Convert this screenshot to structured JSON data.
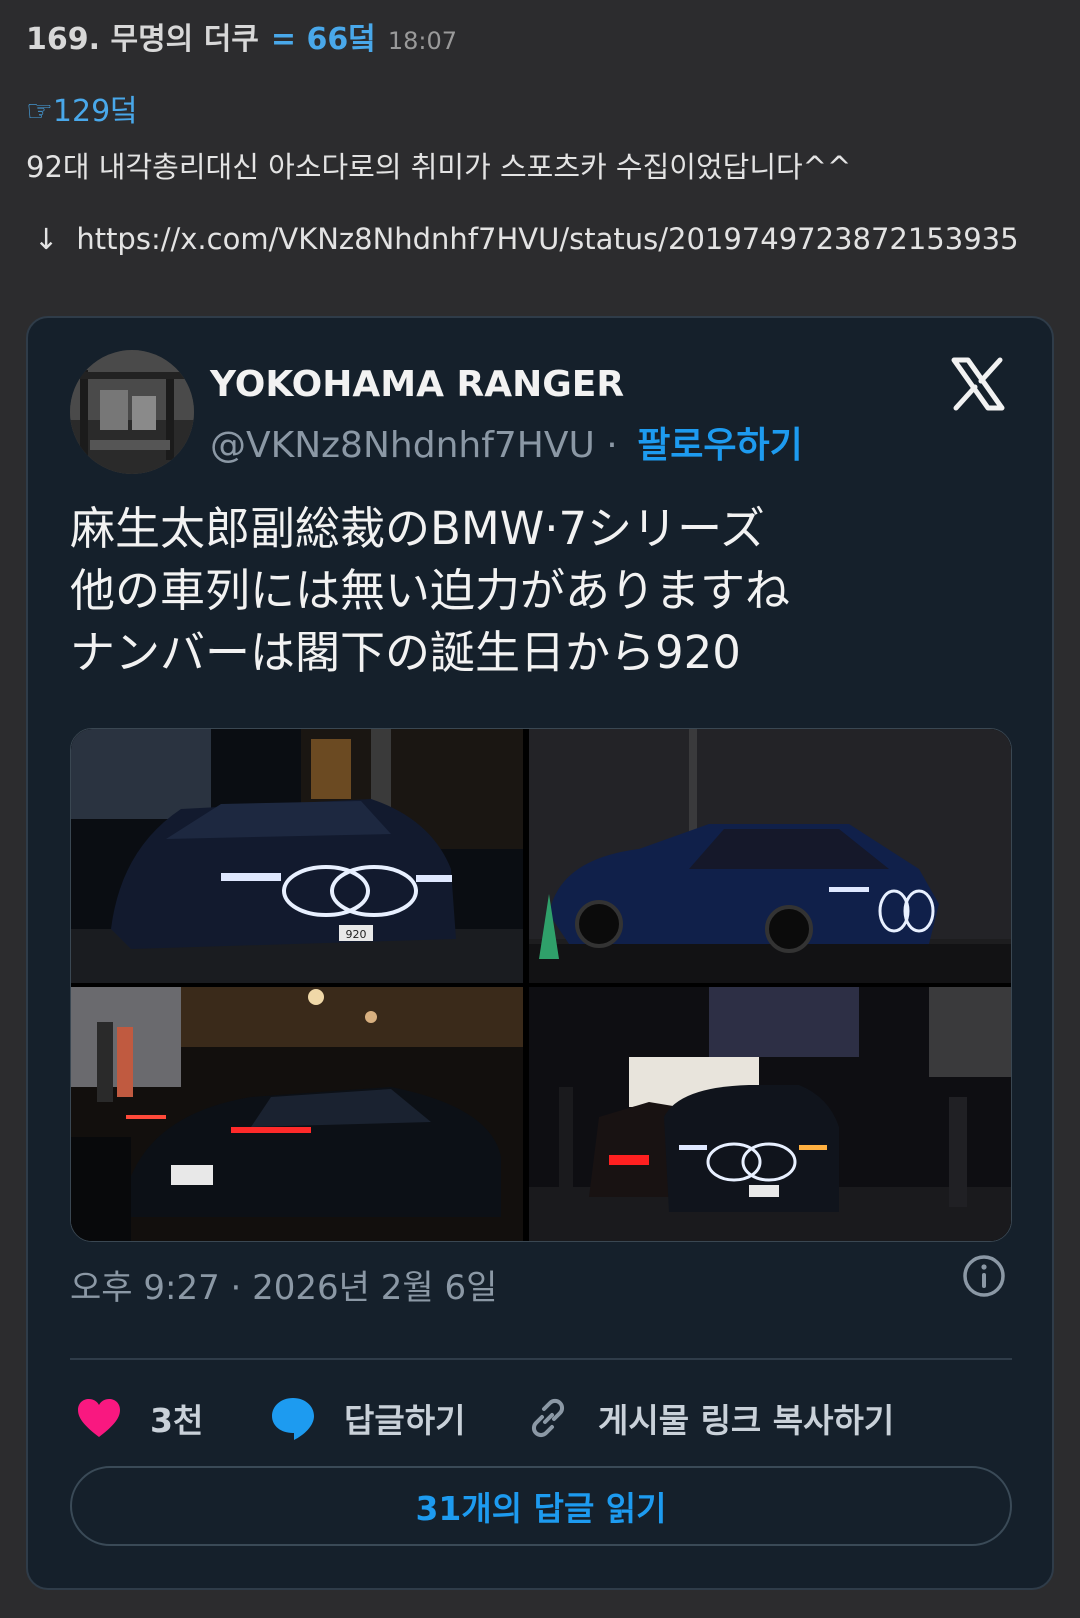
{
  "post": {
    "number": "169. 무명의 더쿠",
    "score": "= 66덬",
    "time": "18:07",
    "reply_ref": "☞129덬",
    "text": "92대 내각총리대신 아소다로의 취미가 스포츠카 수집이었답니다^^",
    "link_arrow": "↓",
    "link": "https://x.com/VKNz8Nhdnhf7HVU/status/2019749723872153935"
  },
  "tweet": {
    "author_name": "YOKOHAMA RANGER",
    "handle": "@VKNz8Nhdnhf7HVU",
    "separator": "·",
    "follow_label": "팔로우하기",
    "lines": [
      "麻生太郎副総裁のBMW·7シリーズ",
      "他の車列には無い迫力がありますね",
      "ナンバーは閣下の誕生日から920"
    ],
    "plate_text": "920",
    "date": "오후 9:27 · 2026년 2월 6일",
    "likes": "3천",
    "reply_label": "답글하기",
    "copy_link_label": "게시물 링크 복사하기",
    "read_replies_label": "31개의 답글 읽기"
  },
  "colors": {
    "accent": "#1d9bf0",
    "score": "#49a8ea",
    "heart": "#f91880",
    "card_bg": "#15202b"
  },
  "icons": [
    "x-logo-icon",
    "info-icon",
    "heart-icon",
    "reply-bubble-icon",
    "link-icon"
  ]
}
